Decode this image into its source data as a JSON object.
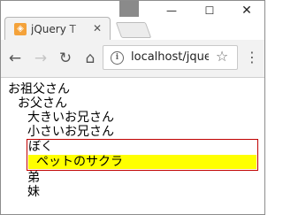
{
  "window": {
    "minimize_glyph": "—",
    "maximize_glyph": "☐",
    "close_glyph": "✕"
  },
  "tab": {
    "title": "jQuery T",
    "favicon_glyph": "◈",
    "close_glyph": "✕"
  },
  "toolbar": {
    "back_glyph": "←",
    "forward_glyph": "→",
    "reload_glyph": "↻",
    "home_glyph": "⌂",
    "info_glyph": "i",
    "url": "localhost/jque",
    "star_glyph": "☆",
    "menu_glyph": "⋮"
  },
  "page": {
    "grandmother": "お祖父さん",
    "father": "お父さん",
    "big_brother": "大きいお兄さん",
    "small_brother": "小さいお兄さん",
    "me": "ぼく",
    "pet": "ペットのサクラ",
    "younger_brother": "弟",
    "younger_sister": "妹"
  },
  "colors": {
    "highlight": "#ffff00",
    "box_border": "#c00000",
    "favicon": "#f4a23a"
  },
  "icons": {
    "favicon": "jquery-favicon-icon",
    "back": "back-arrow-icon",
    "forward": "forward-arrow-icon",
    "reload": "reload-icon",
    "home": "home-icon",
    "info": "info-icon",
    "star": "bookmark-star-icon",
    "menu": "kebab-menu-icon",
    "profile": "profile-icon"
  }
}
